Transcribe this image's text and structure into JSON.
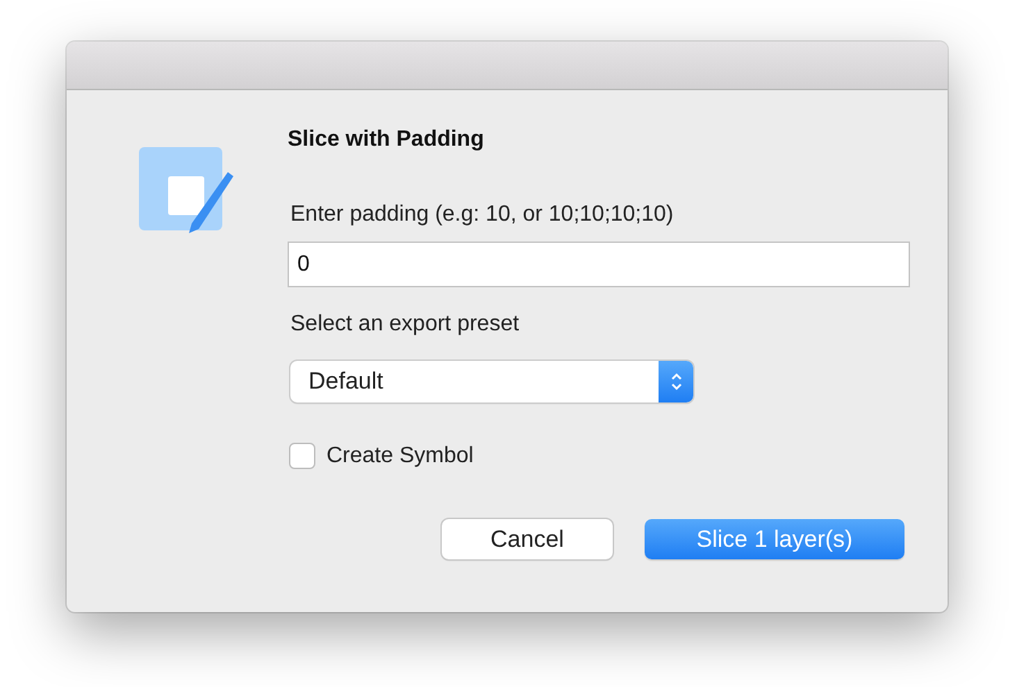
{
  "dialog": {
    "title": "Slice with Padding",
    "padding_label": "Enter padding (e.g: 10, or 10;10;10;10)",
    "padding_field": {
      "value": "0"
    },
    "preset_label": "Select an export preset",
    "preset_select": {
      "value": "Default"
    },
    "create_symbol": {
      "label": "Create Symbol",
      "checked": false
    },
    "buttons": [
      {
        "label": "Cancel",
        "kind": "default"
      },
      {
        "label": "Slice 1 layer(s)",
        "kind": "primary"
      }
    ]
  }
}
